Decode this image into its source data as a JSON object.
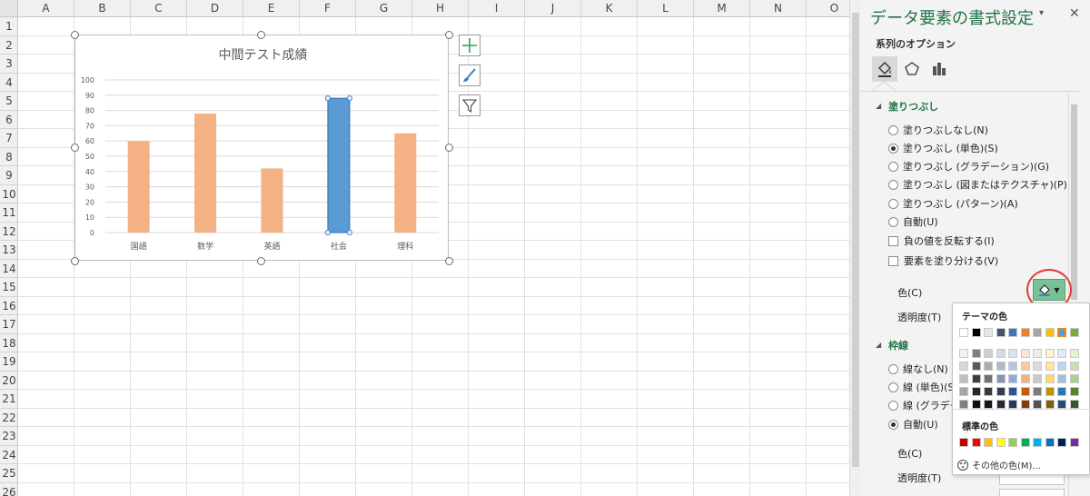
{
  "sheet": {
    "columns": [
      "A",
      "B",
      "C",
      "D",
      "E",
      "F",
      "G",
      "H",
      "I",
      "J",
      "K",
      "L",
      "M",
      "N",
      "O"
    ],
    "rows": [
      "1",
      "2",
      "3",
      "4",
      "5",
      "6",
      "7",
      "8",
      "9",
      "10",
      "11",
      "12",
      "13",
      "14",
      "15",
      "16",
      "17",
      "18",
      "19",
      "20",
      "21",
      "22",
      "23",
      "24",
      "25",
      "26"
    ]
  },
  "chart_data": {
    "type": "bar",
    "title": "中間テスト成績",
    "categories": [
      "国語",
      "数学",
      "英語",
      "社会",
      "理科"
    ],
    "values": [
      60,
      78,
      42,
      88,
      65
    ],
    "ylim": [
      0,
      100
    ],
    "yticks": [
      "0",
      "10",
      "20",
      "30",
      "40",
      "50",
      "60",
      "70",
      "80",
      "90",
      "100"
    ],
    "grid": true,
    "legend": "none",
    "bar_color": "#f4b183",
    "selected_index": 3,
    "selected_color": "#5b9bd5"
  },
  "chart_buttons": [
    "plus-icon",
    "brush-icon",
    "filter-icon"
  ],
  "panel": {
    "title": "データ要素の書式設定",
    "series_options": "系列のオプション",
    "tabs": [
      "fill-line-icon",
      "effects-pentagon-icon",
      "series-options-bars-icon"
    ],
    "fill_section": "塗りつぶし",
    "fill_options": [
      {
        "label": "塗りつぶしなし(N)",
        "checked": false
      },
      {
        "label": "塗りつぶし (単色)(S)",
        "checked": true
      },
      {
        "label": "塗りつぶし (グラデーション)(G)",
        "checked": false
      },
      {
        "label": "塗りつぶし (図またはテクスチャ)(P)",
        "checked": false
      },
      {
        "label": "塗りつぶし (パターン)(A)",
        "checked": false
      },
      {
        "label": "自動(U)",
        "checked": false
      }
    ],
    "fill_checks": [
      "負の値を反転する(I)",
      "要素を塗り分ける(V)"
    ],
    "color_label": "色(C)",
    "transparency_label": "透明度(T)",
    "color_button_value": "#79c295",
    "border_section": "枠線",
    "border_options": [
      {
        "label": "線なし(N)",
        "checked": false
      },
      {
        "label": "線 (単色)(S",
        "checked": false
      },
      {
        "label": "線 (グラデー",
        "checked": false
      },
      {
        "label": "自動(U)",
        "checked": true
      }
    ],
    "border_color_label": "色(C)",
    "border_transparency_label": "透明度(T)"
  },
  "palette": {
    "theme_heading": "テーマの色",
    "standard_heading": "標準の色",
    "more_colors": "その他の色(M)...",
    "theme_row": [
      "#ffffff",
      "#000000",
      "#e7e6e6",
      "#44546a",
      "#4472c4",
      "#ed7d31",
      "#a5a5a5",
      "#ffc000",
      "#5b9bd5",
      "#70ad47"
    ],
    "selected_theme_index": 8,
    "tints": [
      [
        "#f2f2f2",
        "#7f7f7f",
        "#d0cece",
        "#d6dce4",
        "#d9e2f3",
        "#fbe5d5",
        "#ededed",
        "#fff2cc",
        "#deebf6",
        "#e2efd9"
      ],
      [
        "#d8d8d8",
        "#595959",
        "#aeabab",
        "#adb9ca",
        "#b4c6e7",
        "#f7cbac",
        "#dbdbdb",
        "#fee599",
        "#bdd7ee",
        "#c5e0b3"
      ],
      [
        "#bfbfbf",
        "#3f3f3f",
        "#757070",
        "#8496b0",
        "#8eaadb",
        "#f4b183",
        "#c9c9c9",
        "#ffd965",
        "#9cc3e5",
        "#a8d08d"
      ],
      [
        "#a5a5a5",
        "#262626",
        "#3a3838",
        "#323f4f",
        "#2f5496",
        "#c55a11",
        "#7b7b7b",
        "#bf9000",
        "#2e75b5",
        "#538135"
      ],
      [
        "#7f7f7f",
        "#0c0c0c",
        "#171616",
        "#222a35",
        "#1f3864",
        "#833c0b",
        "#525252",
        "#7f6000",
        "#1e4e79",
        "#375623"
      ]
    ],
    "standard_row": [
      "#c00000",
      "#ff0000",
      "#ffc000",
      "#ffff00",
      "#92d050",
      "#00b050",
      "#00b0f0",
      "#0070c0",
      "#002060",
      "#7030a0"
    ]
  }
}
